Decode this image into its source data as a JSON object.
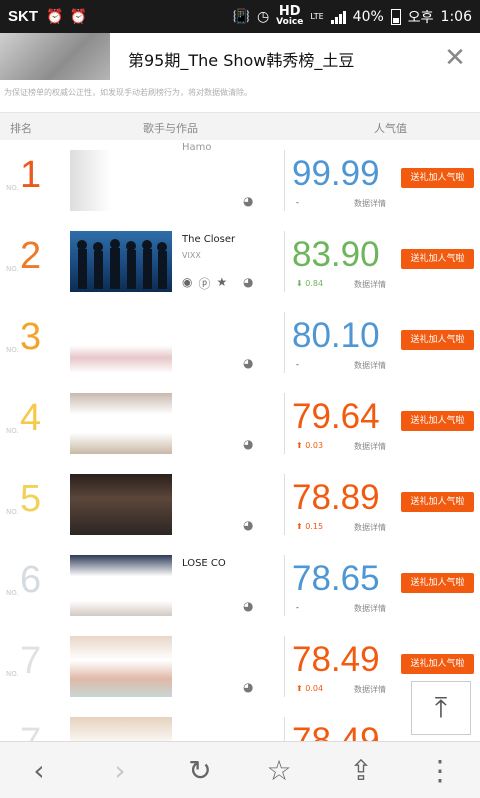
{
  "status_bar": {
    "carrier": "SKT",
    "voice_top": "HD",
    "voice_bottom": "Voice",
    "network": "LTE",
    "battery": "40%",
    "ampm": "오후",
    "time": "1:06"
  },
  "header": {
    "title": "第95期_The Show韩秀榜_土豆",
    "close_icon": "close-icon"
  },
  "notice": "为保证榜单的权威公正性，如发现手动若刷榜行为，将对数据做清除。",
  "table": {
    "col_rank": "排名",
    "col_song": "歌手与作品",
    "col_pop": "人气值"
  },
  "rows": [
    {
      "rank": "1",
      "no": "NO.",
      "song": "Hamo",
      "artist": "",
      "score": "99.99",
      "delta": "-",
      "details": "数据详情",
      "vote": "送礼加人气啦"
    },
    {
      "rank": "2",
      "no": "NO.",
      "song": "The Closer",
      "artist": "VIXX",
      "score": "83.90",
      "delta": "0.84",
      "details": "数据详情",
      "vote": "送礼加人气啦"
    },
    {
      "rank": "3",
      "no": "NO.",
      "song": "",
      "artist": "",
      "score": "80.10",
      "delta": "-",
      "details": "数据详情",
      "vote": "送礼加人气啦"
    },
    {
      "rank": "4",
      "no": "NO.",
      "song": "",
      "artist": "",
      "score": "79.64",
      "delta": "0.03",
      "details": "数据详情",
      "vote": "送礼加人气啦"
    },
    {
      "rank": "5",
      "no": "NO.",
      "song": "",
      "artist": "",
      "score": "78.89",
      "delta": "0.15",
      "details": "数据详情",
      "vote": "送礼加人气啦"
    },
    {
      "rank": "6",
      "no": "NO.",
      "song": "LOSE CO",
      "artist": "",
      "score": "78.65",
      "delta": "-",
      "details": "数据详情",
      "vote": "送礼加人气啦"
    },
    {
      "rank": "7",
      "no": "NO.",
      "song": "",
      "artist": "",
      "score": "78.49",
      "delta": "0.04",
      "details": "数据详情",
      "vote": "送礼加人气啦"
    },
    {
      "rank": "7",
      "no": "NO.",
      "song": "",
      "artist": "",
      "score": "78.49",
      "delta": "",
      "details": "",
      "vote": ""
    }
  ],
  "colors": {
    "orange": "#f25a0f",
    "blue": "#4f97d4",
    "green": "#6bb55a",
    "rank1": "#e95b1c",
    "rank2": "#ec7a28",
    "rank3": "#f3a327",
    "rank4": "#f6c94b",
    "rank5": "#f0d25a",
    "rank6": "#d5dbe0",
    "rank7": "#dfe2e5"
  }
}
